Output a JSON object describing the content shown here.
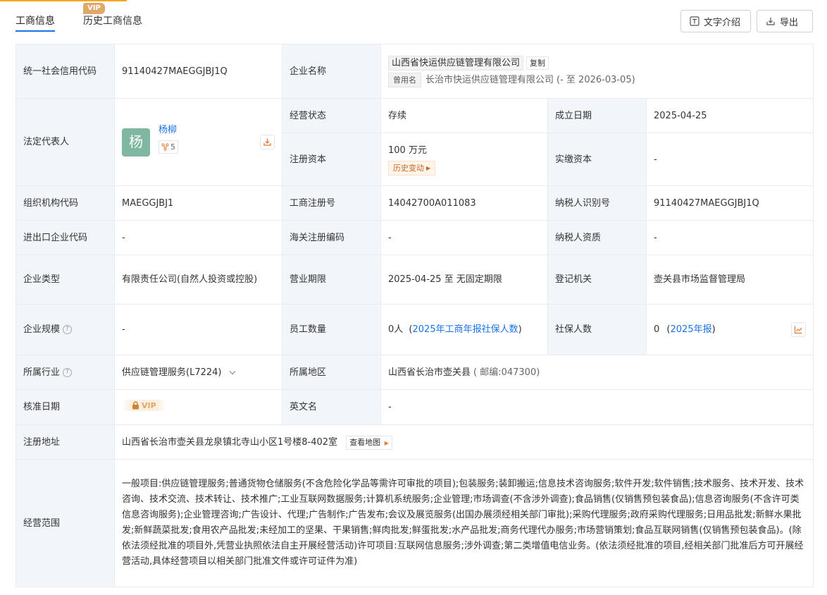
{
  "tabs": [
    {
      "label": "工商信息"
    },
    {
      "label": "历史工商信息",
      "badge": "VIP"
    }
  ],
  "actions": {
    "text_intro": "文字介绍",
    "export": "导出"
  },
  "info": {
    "credit_code_label": "统一社会信用代码",
    "credit_code": "91140427MAEGGJBJ1Q",
    "company_name_label": "企业名称",
    "company_name": "山西省快运供应链管理有限公司",
    "copy_label": "复制",
    "used_name_tag": "曾用名",
    "used_name": "长治市快运供应链管理有限公司",
    "used_name_period": "(- 至 2026-03-05)",
    "legal_rep_label": "法定代表人",
    "legal_rep_avatar": "杨",
    "legal_rep_name": "杨柳",
    "legal_rep_count": "5",
    "status_label": "经营状态",
    "status": "存续",
    "established_label": "成立日期",
    "established": "2025-04-25",
    "reg_capital_label": "注册资本",
    "reg_capital": "100 万元",
    "history_change": "历史变动",
    "paid_capital_label": "实缴资本",
    "paid_capital": "-",
    "org_code_label": "组织机构代码",
    "org_code": "MAEGGJBJ1",
    "reg_no_label": "工商注册号",
    "reg_no": "14042700A011083",
    "taxpayer_id_label": "纳税人识别号",
    "taxpayer_id": "91140427MAEGGJBJ1Q",
    "import_export_label": "进出口企业代码",
    "import_export": "-",
    "customs_label": "海关注册编码",
    "customs": "-",
    "taxpayer_qual_label": "纳税人资质",
    "taxpayer_qual": "-",
    "type_label": "企业类型",
    "type": "有限责任公司(自然人投资或控股)",
    "term_label": "营业期限",
    "term": "2025-04-25 至 无固定期限",
    "authority_label": "登记机关",
    "authority": "壶关县市场监督管理局",
    "scale_label": "企业规模",
    "scale": "-",
    "employees_label": "员工数量",
    "employees": "0人",
    "employees_source": "2025年工商年报社保人数",
    "social_label": "社保人数",
    "social": "0",
    "social_source": "2025年报",
    "industry_label": "所属行业",
    "industry": "供应链管理服务(L7224)",
    "region_label": "所属地区",
    "region": "山西省长治市壶关县",
    "postcode": "( 邮编:047300)",
    "approve_label": "核准日期",
    "approve_vip": "VIP",
    "english_label": "英文名",
    "english": "-",
    "address_label": "注册地址",
    "address": "山西省长治市壶关县龙泉镇北寺山小区1号楼8-402室",
    "view_map": "查看地图",
    "scope_label": "经营范围",
    "scope": "一般项目:供应链管理服务;普通货物仓储服务(不含危险化学品等需许可审批的项目);包装服务;装卸搬运;信息技术咨询服务;软件开发;软件销售;技术服务、技术开发、技术咨询、技术交流、技术转让、技术推广;工业互联网数据服务;计算机系统服务;企业管理;市场调查(不含涉外调查);食品销售(仅销售预包装食品);信息咨询服务(不含许可类信息咨询服务);企业管理咨询;广告设计、代理;广告制作;广告发布;会议及展览服务(出国办展须经相关部门审批);采购代理服务;政府采购代理服务;日用品批发;新鲜水果批发;新鲜蔬菜批发;食用农产品批发;未经加工的坚果、干果销售;鲜肉批发;鲜蛋批发;水产品批发;商务代理代办服务;市场营销策划;食品互联网销售(仅销售预包装食品)。(除依法须经批准的项目外,凭营业执照依法自主开展经营活动)许可项目:互联网信息服务;涉外调查;第二类增值电信业务。(依法须经批准的项目,经相关部门批准后方可开展经营活动,具体经营项目以相关部门批准文件或许可证件为准)"
  },
  "colors": {
    "accent": "#1a73e8",
    "label_bg": "#f2f6fb",
    "vip": "#e0a96a",
    "warn": "#c46a23"
  },
  "icons": [
    "text-icon",
    "export-icon",
    "download-icon",
    "relation-icon",
    "caret-right-icon",
    "chevron-down-icon",
    "help-icon",
    "trend-chart-icon",
    "lock-icon"
  ]
}
